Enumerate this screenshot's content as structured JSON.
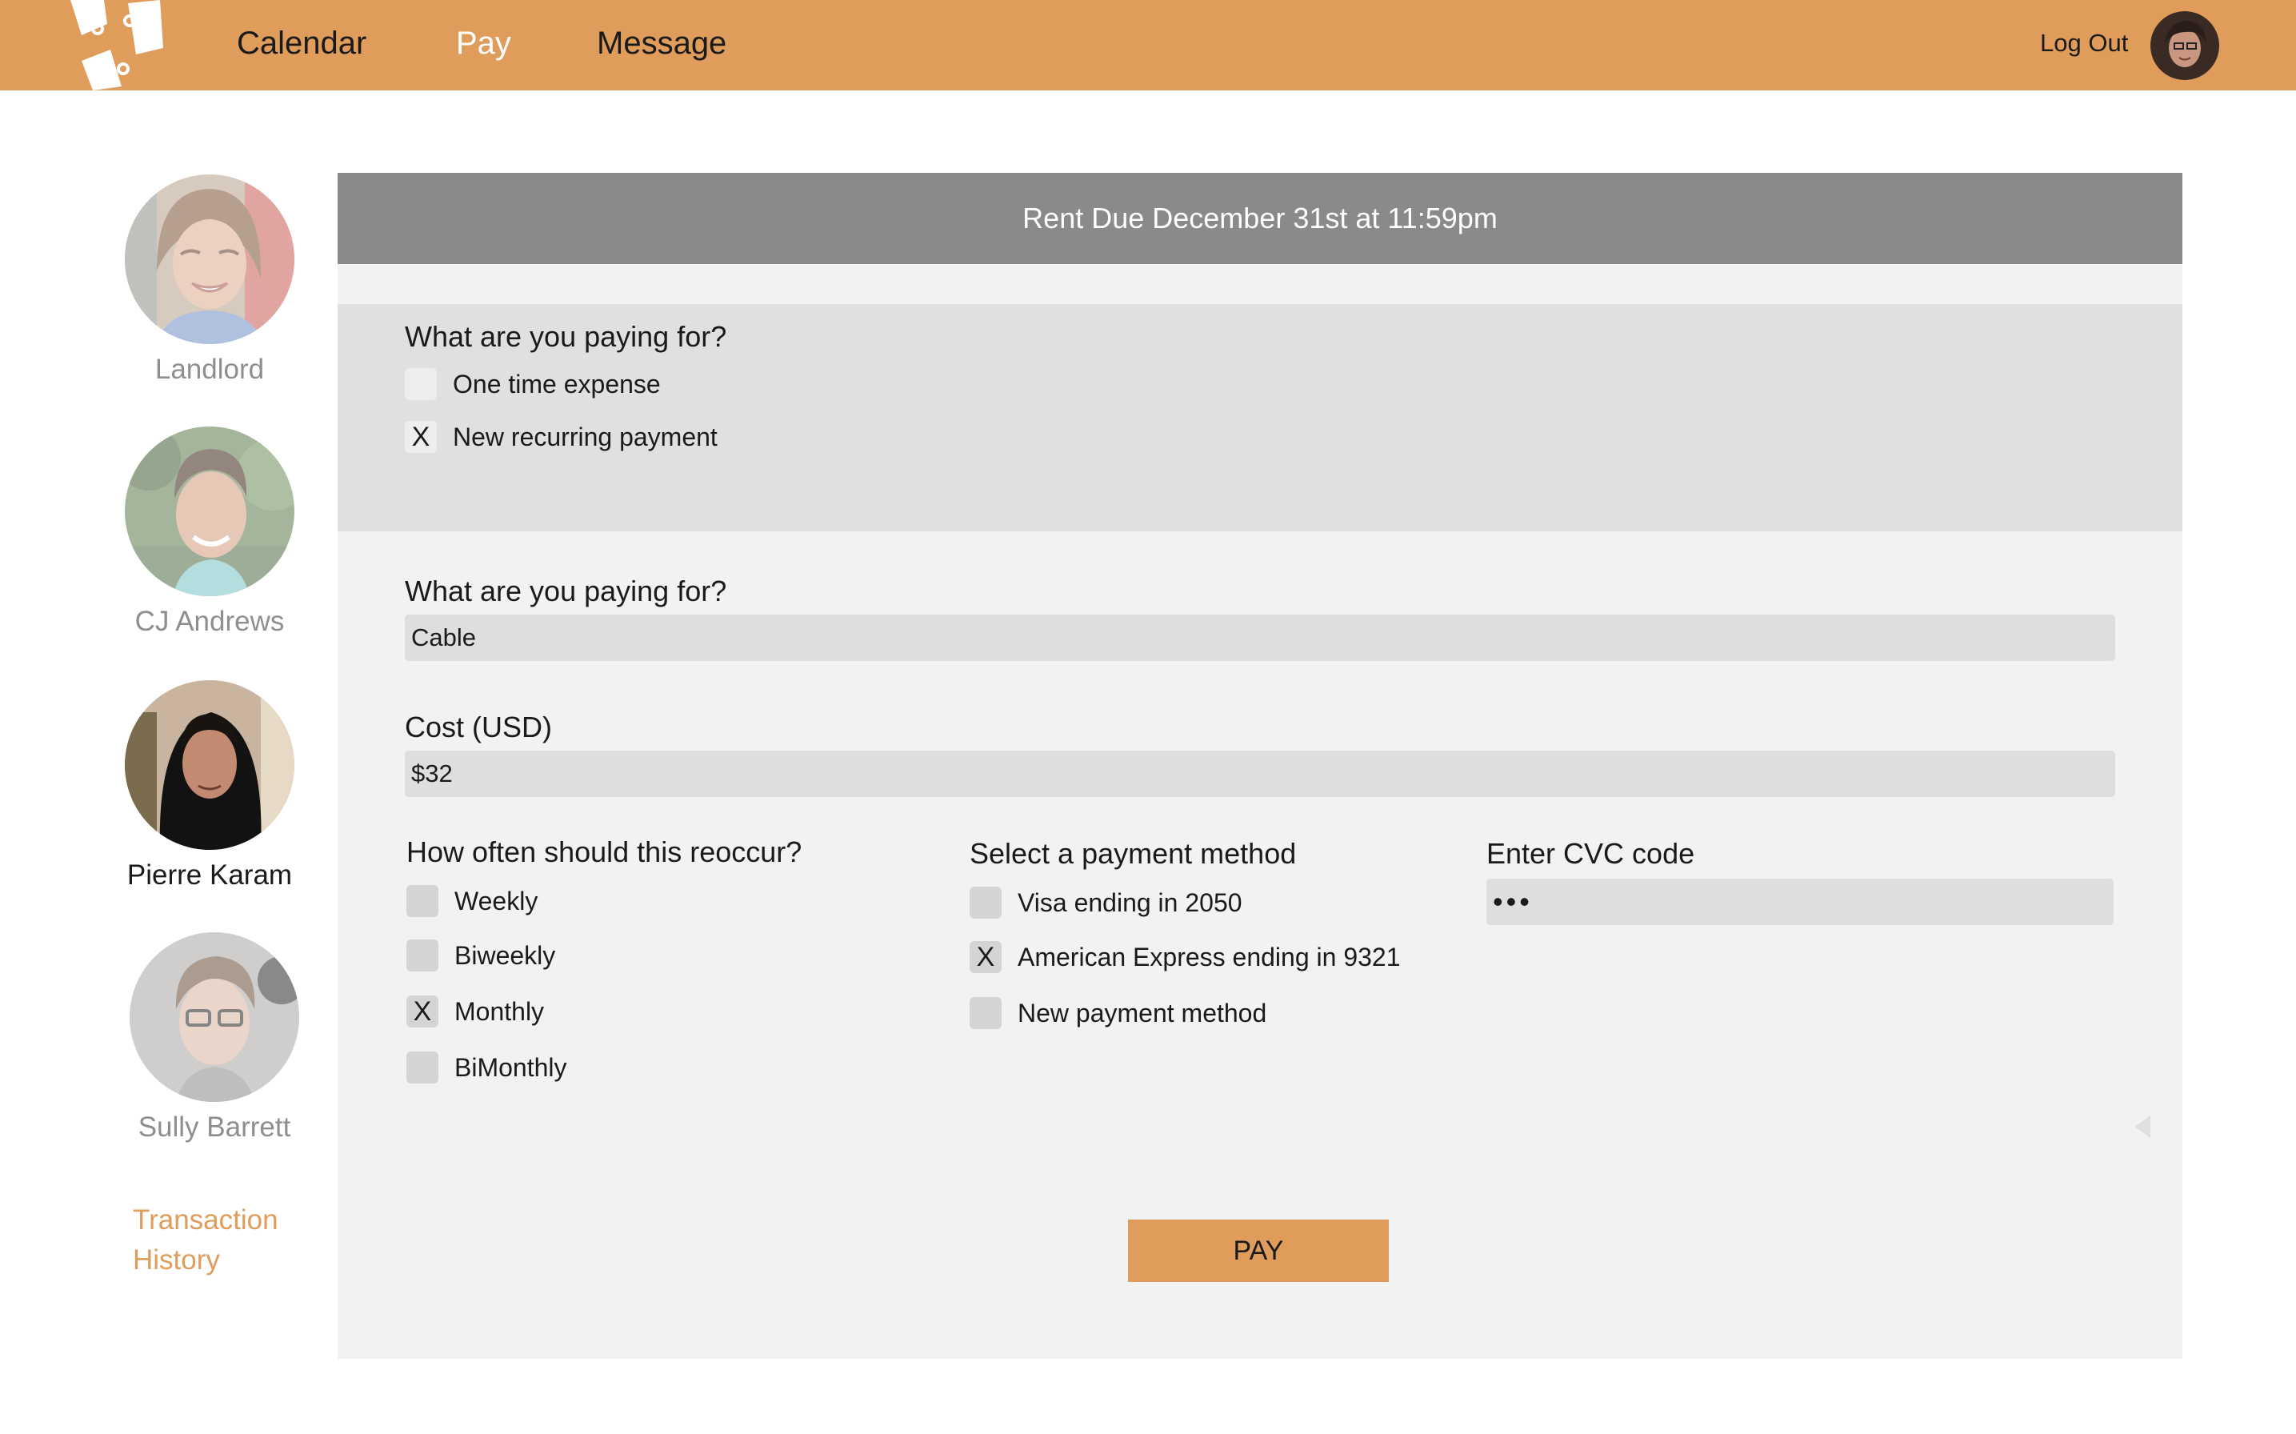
{
  "nav": {
    "items": [
      {
        "label": "Calendar"
      },
      {
        "label": "Pay"
      },
      {
        "label": "Message"
      }
    ],
    "logout_label": "Log Out"
  },
  "sidebar": {
    "people": [
      {
        "name": "Landlord"
      },
      {
        "name": "CJ Andrews"
      },
      {
        "name": "Pierre Karam"
      },
      {
        "name": "Sully Barrett"
      }
    ],
    "transaction_history_label": "Transaction History"
  },
  "banner": {
    "text": "Rent Due December 31st at 11:59pm"
  },
  "payment_type": {
    "question": "What are you paying for?",
    "options": [
      {
        "label": "One time expense",
        "checked": ""
      },
      {
        "label": "New recurring payment",
        "checked": "X"
      }
    ]
  },
  "form": {
    "description_label": "What are you paying for?",
    "description_value": "Cable",
    "cost_label": "Cost (USD)",
    "cost_value": "$32",
    "frequency": {
      "label": "How often should this reoccur?",
      "options": [
        {
          "label": "Weekly",
          "checked": ""
        },
        {
          "label": "Biweekly",
          "checked": ""
        },
        {
          "label": "Monthly",
          "checked": "X"
        },
        {
          "label": "BiMonthly",
          "checked": ""
        }
      ]
    },
    "payment_method": {
      "label": "Select a payment method",
      "options": [
        {
          "label": "Visa ending in 2050",
          "checked": ""
        },
        {
          "label": "American Express ending in 9321",
          "checked": "X"
        },
        {
          "label": "New payment method",
          "checked": ""
        }
      ]
    },
    "cvc": {
      "label": "Enter CVC code",
      "value": "•••"
    },
    "pay_label": "PAY"
  },
  "colors": {
    "accent": "#df9c5b",
    "banner": "#8a8a8a",
    "panel": "#f2f2f2"
  }
}
